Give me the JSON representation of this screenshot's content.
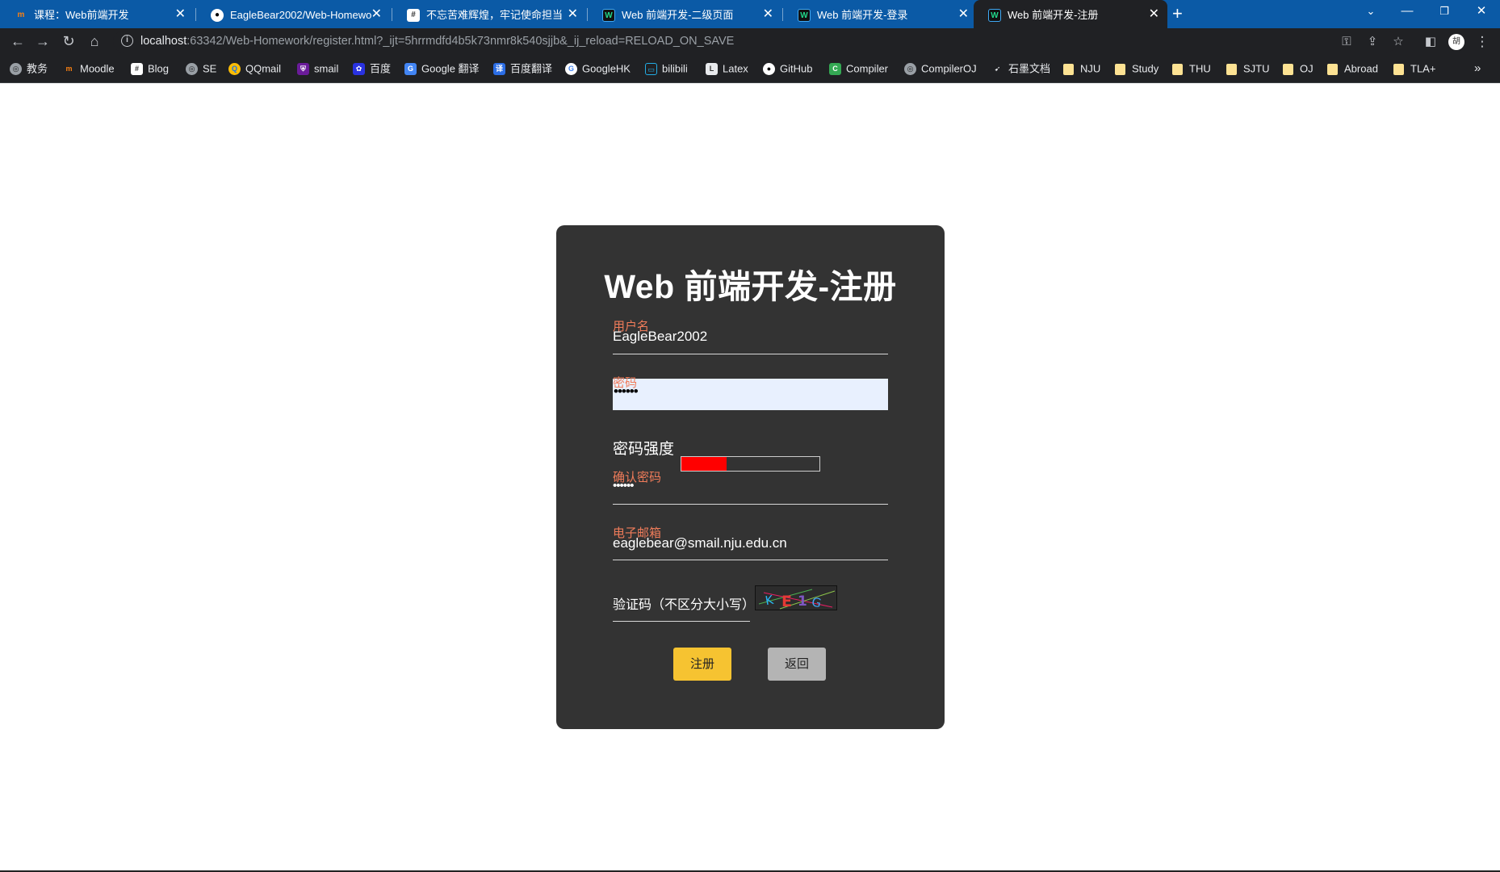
{
  "browser": {
    "tabs": [
      {
        "title": "课程：Web前端开发",
        "icon": "moodle-icon"
      },
      {
        "title": "EagleBear2002/Web-Homewo",
        "icon": "github-icon"
      },
      {
        "title": "不忘苦难辉煌，牢记使命担当",
        "icon": "site-icon"
      },
      {
        "title": "Web 前端开发-二级页面",
        "icon": "webstorm-icon"
      },
      {
        "title": "Web 前端开发-登录",
        "icon": "webstorm-icon"
      },
      {
        "title": "Web 前端开发-注册",
        "icon": "webstorm-icon",
        "active": true
      }
    ],
    "url_host": "localhost",
    "url_rest": ":63342/Web-Homework/register.html?_ijt=5hrrmdfd4b5k73nmr8k540sjjb&_ij_reload=RELOAD_ON_SAVE",
    "profile_initial": "胡"
  },
  "bookmarks": [
    {
      "label": "教务",
      "icon": "globe-icon"
    },
    {
      "label": "Moodle",
      "icon": "moodle-icon"
    },
    {
      "label": "Blog",
      "icon": "blog-icon"
    },
    {
      "label": "SE",
      "icon": "globe-icon"
    },
    {
      "label": "QQmail",
      "icon": "qqmail-icon"
    },
    {
      "label": "smail",
      "icon": "smail-icon"
    },
    {
      "label": "百度",
      "icon": "baidu-icon"
    },
    {
      "label": "Google 翻译",
      "icon": "google-translate-icon"
    },
    {
      "label": "百度翻译",
      "icon": "baidu-translate-icon"
    },
    {
      "label": "GoogleHK",
      "icon": "google-icon"
    },
    {
      "label": "bilibili",
      "icon": "bilibili-icon"
    },
    {
      "label": "Latex",
      "icon": "latex-icon"
    },
    {
      "label": "GitHub",
      "icon": "github-icon"
    },
    {
      "label": "Compiler",
      "icon": "compiler-icon"
    },
    {
      "label": "CompilerOJ",
      "icon": "globe-icon"
    },
    {
      "label": "石墨文档",
      "icon": "shimo-icon"
    },
    {
      "label": "NJU",
      "icon": "folder-icon"
    },
    {
      "label": "Study",
      "icon": "folder-icon"
    },
    {
      "label": "THU",
      "icon": "folder-icon"
    },
    {
      "label": "SJTU",
      "icon": "folder-icon"
    },
    {
      "label": "OJ",
      "icon": "folder-icon"
    },
    {
      "label": "Abroad",
      "icon": "folder-icon"
    },
    {
      "label": "TLA+",
      "icon": "folder-icon"
    }
  ],
  "page": {
    "title": "Web 前端开发-注册",
    "username": {
      "label": "用户名",
      "value": "EagleBear2002"
    },
    "password": {
      "label": "密码",
      "value": "••••••"
    },
    "strength": {
      "label": "密码强度",
      "level": 0.33,
      "color": "#ff0000"
    },
    "confirm": {
      "label": "确认密码",
      "value": "••••••"
    },
    "email": {
      "label": "电子邮箱",
      "value": "eaglebear@smail.nju.edu.cn"
    },
    "captcha": {
      "label": "验证码（不区分大小写）",
      "code": "KE1G"
    },
    "buttons": {
      "register": "注册",
      "back": "返回"
    }
  }
}
